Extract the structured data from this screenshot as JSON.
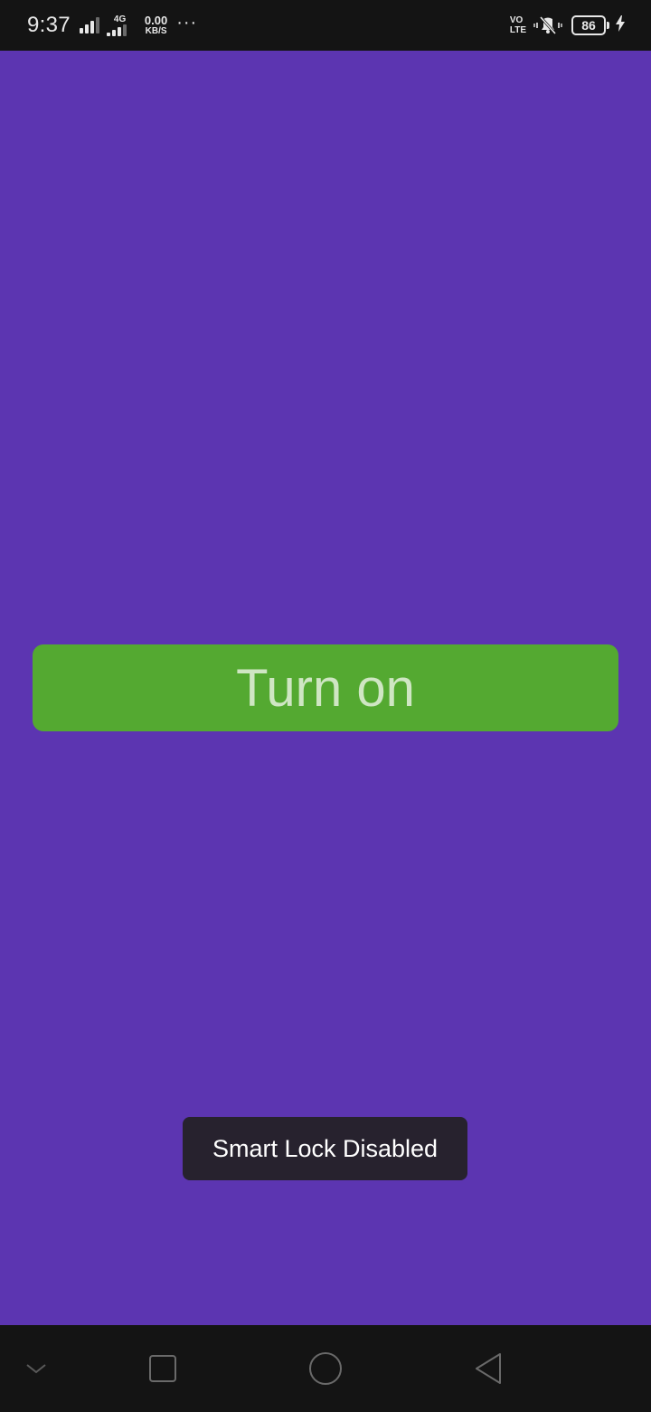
{
  "status_bar": {
    "time": "9:37",
    "network_type": "4G",
    "speed_value": "0.00",
    "speed_unit": "KB/S",
    "more": "···",
    "volte_top": "VO",
    "volte_bottom": "LTE",
    "battery_level": "86"
  },
  "main": {
    "turn_on_label": "Turn on",
    "toast_message": "Smart Lock Disabled"
  },
  "nav_bar": {
    "icons": [
      "chevron-down-icon",
      "recents-square-icon",
      "home-circle-icon",
      "back-triangle-icon"
    ]
  },
  "colors": {
    "background": "#5c35b1",
    "button": "#54a931",
    "button_text": "#cfe6c3",
    "toast": "#27222e",
    "system_bar": "#141414"
  }
}
